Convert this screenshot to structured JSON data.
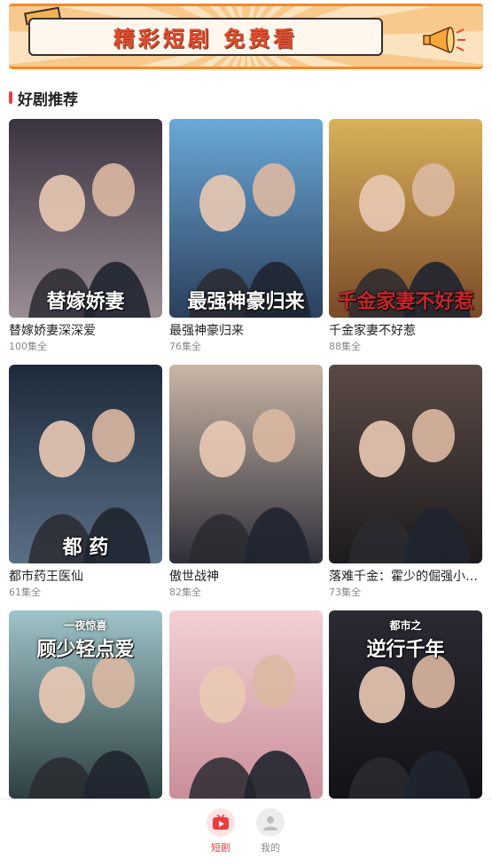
{
  "banner": {
    "title": "精彩短剧 免费看"
  },
  "section": {
    "title": "好剧推荐"
  },
  "dramas": [
    {
      "title": "替嫁娇妻深深爱",
      "episodes": "100集全",
      "poster_text": "替嫁娇妻",
      "colors": [
        "#3a3340",
        "#9a8c93"
      ]
    },
    {
      "title": "最强神豪归来",
      "episodes": "76集全",
      "poster_text": "最强神豪归来",
      "colors": [
        "#6aa9d8",
        "#2b3f5c"
      ]
    },
    {
      "title": "千金家妻不好惹",
      "episodes": "88集全",
      "poster_text": "千金家妻不好惹",
      "colors": [
        "#d8b25a",
        "#7a4a2a"
      ]
    },
    {
      "title": "都市药王医仙",
      "episodes": "61集全",
      "poster_text": "都 药",
      "colors": [
        "#1d2a3a",
        "#5a6e86"
      ]
    },
    {
      "title": "傲世战神",
      "episodes": "82集全",
      "poster_text": "",
      "colors": [
        "#c9b6a6",
        "#2e2f3a"
      ]
    },
    {
      "title": "落难千金：霍少的倔强小…",
      "episodes": "73集全",
      "poster_text": "",
      "colors": [
        "#5a4a46",
        "#1d1b1d"
      ]
    },
    {
      "title": "",
      "episodes": "",
      "poster_text": "顾少轻点爱",
      "poster_sub": "一夜惊喜",
      "colors": [
        "#9fc4c8",
        "#2d3f40"
      ]
    },
    {
      "title": "",
      "episodes": "",
      "poster_text": "",
      "colors": [
        "#f3d0d4",
        "#c98f9a"
      ]
    },
    {
      "title": "",
      "episodes": "",
      "poster_text": "逆行千年",
      "poster_sub": "都市之",
      "colors": [
        "#2b2a33",
        "#121216"
      ]
    }
  ],
  "nav": {
    "items": [
      {
        "label": "短剧",
        "icon": "play-icon",
        "active": true,
        "color": "#ee3b3b"
      },
      {
        "label": "我的",
        "icon": "user-icon",
        "active": false,
        "color": "#888888"
      }
    ]
  }
}
